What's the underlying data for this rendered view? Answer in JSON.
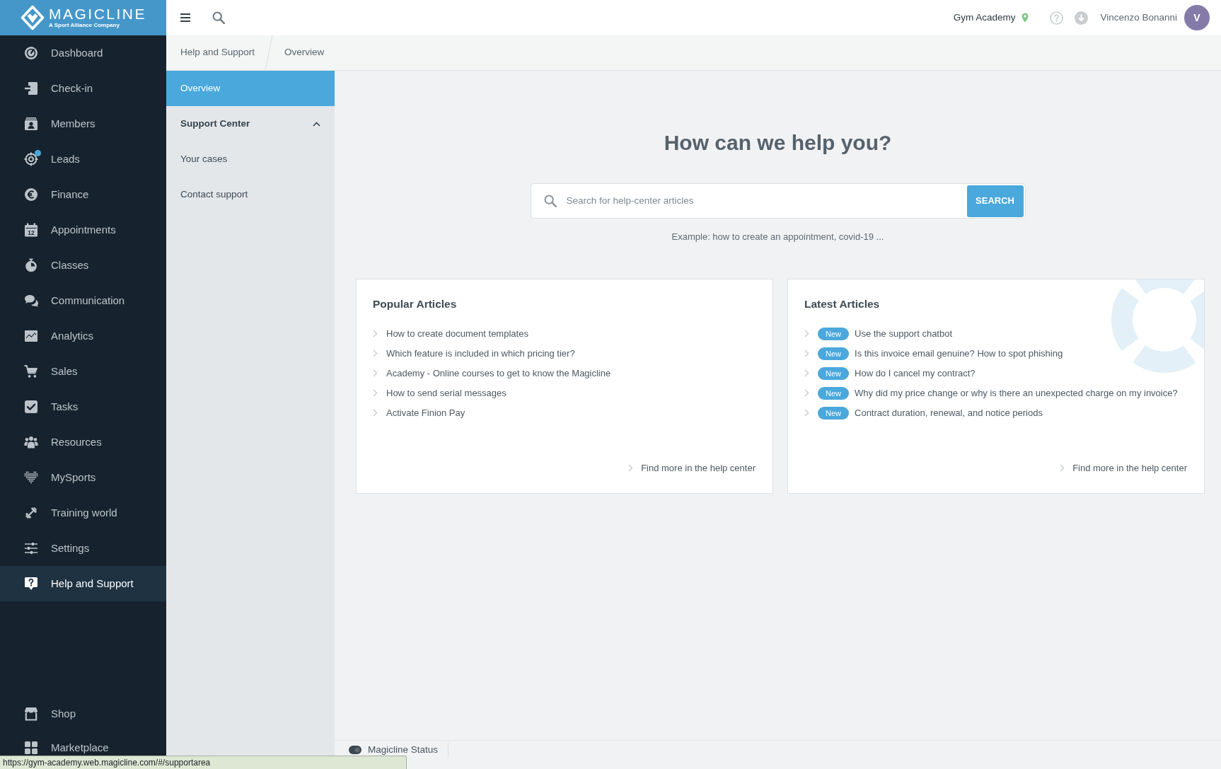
{
  "sidebar": {
    "logo": {
      "name": "MAGICLINE",
      "tagline": "A Sport Alliance Company"
    },
    "items": [
      {
        "label": "Dashboard",
        "selected": false,
        "notification": false
      },
      {
        "label": "Check-in",
        "selected": false,
        "notification": false
      },
      {
        "label": "Members",
        "selected": false,
        "notification": false
      },
      {
        "label": "Leads",
        "selected": false,
        "notification": true
      },
      {
        "label": "Finance",
        "selected": false,
        "notification": false
      },
      {
        "label": "Appointments",
        "selected": false,
        "notification": false,
        "icon_text": "12"
      },
      {
        "label": "Classes",
        "selected": false,
        "notification": false
      },
      {
        "label": "Communication",
        "selected": false,
        "notification": false
      },
      {
        "label": "Analytics",
        "selected": false,
        "notification": false
      },
      {
        "label": "Sales",
        "selected": false,
        "notification": false
      },
      {
        "label": "Tasks",
        "selected": false,
        "notification": false
      },
      {
        "label": "Resources",
        "selected": false,
        "notification": false
      },
      {
        "label": "MySports",
        "selected": false,
        "notification": false
      },
      {
        "label": "Training world",
        "selected": false,
        "notification": false
      },
      {
        "label": "Settings",
        "selected": false,
        "notification": false
      },
      {
        "label": "Help and Support",
        "selected": true,
        "notification": false
      }
    ],
    "bottom_items": [
      {
        "label": "Shop",
        "selected": false
      },
      {
        "label": "Marketplace",
        "selected": false
      }
    ]
  },
  "top_bar": {
    "location": "Gym Academy",
    "user_name": "Vincenzo Bonanni",
    "avatar_initial": "V"
  },
  "breadcrumb": [
    "Help and Support",
    "Overview"
  ],
  "subnav": {
    "items": [
      {
        "label": "Overview",
        "kind": "link",
        "selected": true
      },
      {
        "label": "Support Center",
        "kind": "group",
        "selected": false,
        "expanded": true,
        "children": [
          {
            "label": "Your cases",
            "selected": false
          },
          {
            "label": "Contact support",
            "selected": false
          }
        ]
      }
    ]
  },
  "hero": {
    "title": "How can we help you?",
    "search": {
      "placeholder": "Search for help-center articles",
      "button": "SEARCH"
    },
    "hint": "Example: how to create an appointment, covid-19 ..."
  },
  "cards": [
    {
      "kind": "popular",
      "title": "Popular Articles",
      "articles": [
        {
          "title": "How to create document templates"
        },
        {
          "title": "Which feature is included in which pricing tier?"
        },
        {
          "title": "Academy - Online courses to get to know the Magicline"
        },
        {
          "title": "How to send serial messages"
        },
        {
          "title": "Activate Finion Pay"
        }
      ],
      "more_link": "Find more in the help center"
    },
    {
      "kind": "latest",
      "title": "Latest Articles",
      "articles": [
        {
          "badge": "New",
          "title": "Use the support chatbot"
        },
        {
          "badge": "New",
          "title": "Is this invoice email genuine? How to spot phishing"
        },
        {
          "badge": "New",
          "title": "How do I cancel my contract?"
        },
        {
          "badge": "New",
          "title": "Why did my price change or why is there an unexpected charge on my invoice?"
        },
        {
          "badge": "New",
          "title": "Contract duration, renewal, and notice periods"
        }
      ],
      "more_link": "Find more in the help center"
    }
  ],
  "footer": {
    "status_link": "Magicline Status"
  },
  "browser_status": {
    "url": "https://gym-academy.web.magicline.com/#/supportarea"
  }
}
